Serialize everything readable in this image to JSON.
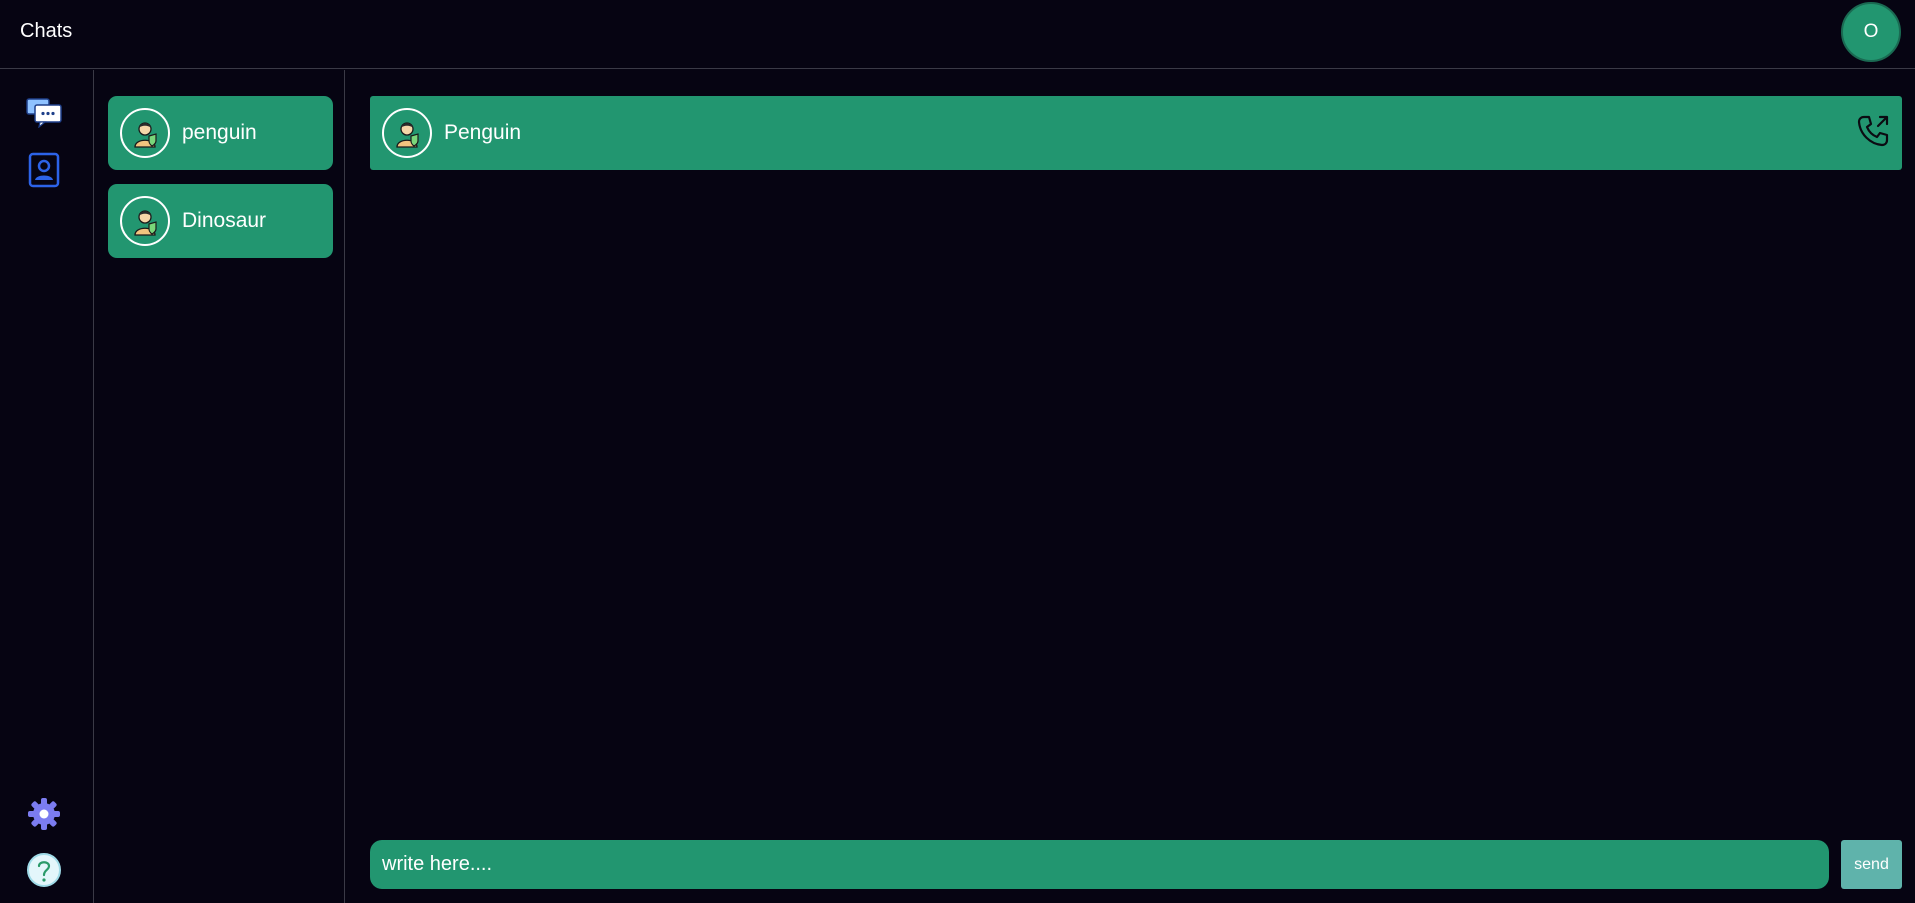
{
  "header": {
    "title": "Chats",
    "profile_initial": "O"
  },
  "rail": {
    "top_icons": [
      "chat-bubbles-icon",
      "contact-card-icon"
    ],
    "bottom_icons": [
      "gear-icon",
      "help-icon"
    ]
  },
  "contacts": [
    {
      "name": "penguin",
      "avatar_icon": "user-shield-icon"
    },
    {
      "name": "Dinosaur",
      "avatar_icon": "user-shield-icon"
    }
  ],
  "chat": {
    "name": "Penguin",
    "avatar_icon": "user-shield-icon",
    "call_icon": "phone-outgoing-icon"
  },
  "composer": {
    "placeholder": "write here....",
    "value": "",
    "send_label": "send"
  },
  "colors": {
    "background": "#060412",
    "accent": "#229670",
    "send": "#5fb3ab",
    "divider": "#3a3a46"
  }
}
